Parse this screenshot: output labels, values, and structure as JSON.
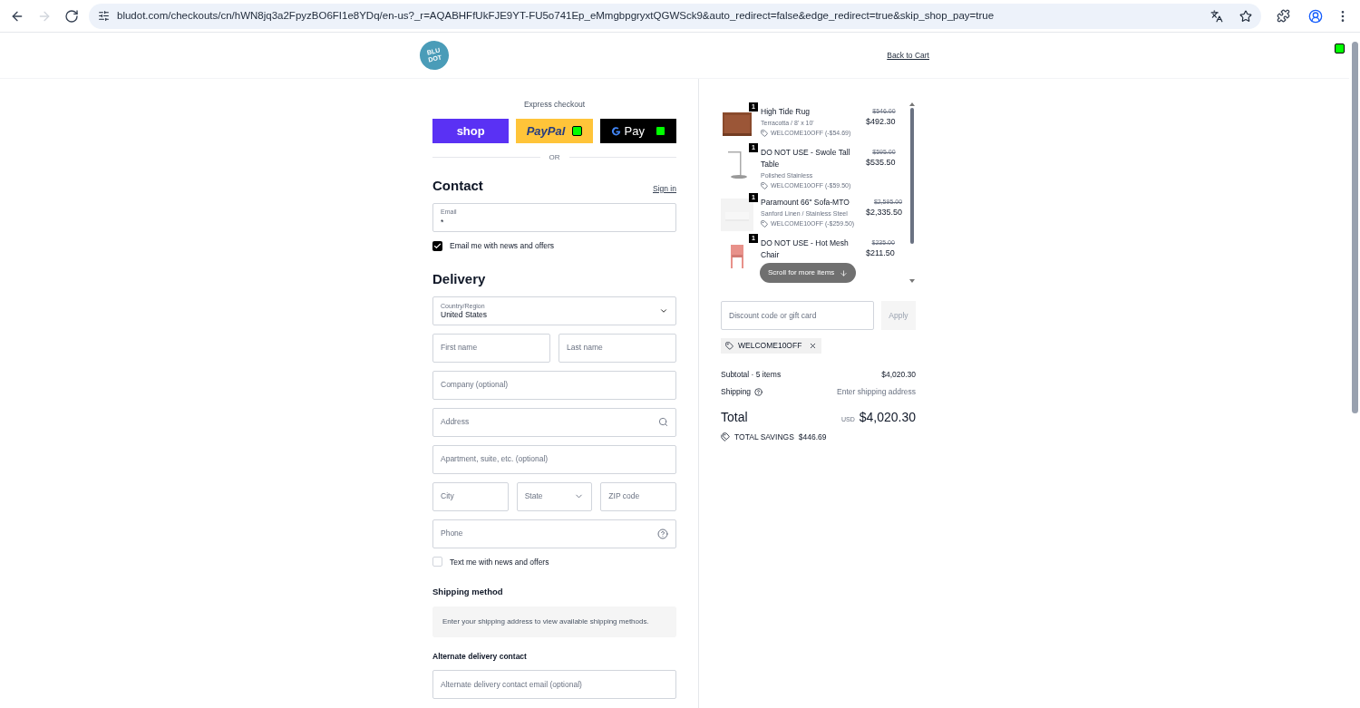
{
  "browser": {
    "url": "bludot.com/checkouts/cn/hWN8jq3a2FpyzBO6FI1e8YDq/en-us?_r=AQABHFfUkFJE9YT-FU5o741Ep_eMmgbpgryxtQGWSck9&auto_redirect=false&edge_redirect=true&skip_shop_pay=true",
    "nav": [
      {
        "kind": "back",
        "disabled": false
      },
      {
        "kind": "forward",
        "disabled": true
      },
      {
        "kind": "reload",
        "disabled": false
      }
    ]
  },
  "header": {
    "logo": [
      "BLU",
      "DOT"
    ],
    "back_link": "Back to Cart"
  },
  "express": {
    "title": "Express checkout",
    "buttons": [
      {
        "kind": "shop",
        "label": "shop"
      },
      {
        "kind": "paypal",
        "label": "PayPal"
      },
      {
        "kind": "gpay",
        "label": "Pay"
      }
    ],
    "divider": "OR"
  },
  "contact": {
    "title": "Contact",
    "sign_in": "Sign in",
    "email": {
      "label": "Email",
      "value": "*"
    },
    "newsletter": {
      "label": "Email me with news and offers",
      "checked": true
    }
  },
  "delivery": {
    "title": "Delivery",
    "country": {
      "label": "Country/Region",
      "value": "United States"
    },
    "fields": [
      [
        {
          "kind": "input",
          "placeholder": "First name"
        },
        {
          "kind": "input",
          "placeholder": "Last name"
        }
      ],
      [
        {
          "kind": "input",
          "placeholder": "Company (optional)"
        }
      ],
      [
        {
          "kind": "search",
          "placeholder": "Address"
        }
      ],
      [
        {
          "kind": "input",
          "placeholder": "Apartment, suite, etc. (optional)"
        }
      ],
      [
        {
          "kind": "input",
          "placeholder": "City"
        },
        {
          "kind": "select",
          "placeholder": "State"
        },
        {
          "kind": "input",
          "placeholder": "ZIP code"
        }
      ],
      [
        {
          "kind": "help",
          "placeholder": "Phone"
        }
      ]
    ],
    "sms": {
      "label": "Text me with news and offers",
      "checked": false
    }
  },
  "shipping": {
    "title": "Shipping method",
    "note": "Enter your shipping address to view available shipping methods."
  },
  "alternate": {
    "title": "Alternate delivery contact",
    "placeholder": "Alternate delivery contact email (optional)"
  },
  "cart": {
    "items": [
      {
        "kind": "rug",
        "qty": "1",
        "name": "High Tide Rug",
        "variant": "Terracotta / 8' x 10'",
        "discount": "WELCOME10OFF (-$54.69)",
        "was": "$546.00",
        "price": "$492.30"
      },
      {
        "kind": "table",
        "qty": "1",
        "name": "DO NOT USE - Swole Tall Table",
        "variant": "Polished Stainless",
        "discount": "WELCOME10OFF (-$59.50)",
        "was": "$595.00",
        "price": "$535.50"
      },
      {
        "kind": "sofa",
        "qty": "1",
        "name": "Paramount 66\" Sofa-MTO",
        "variant": "Sanford Linen / Stainless Steel",
        "discount": "WELCOME10OFF (-$259.50)",
        "was": "$2,595.00",
        "price": "$2,335.50"
      },
      {
        "kind": "chair",
        "qty": "1",
        "name": "DO NOT USE - Hot Mesh Chair",
        "was": "$235.00",
        "price": "$211.50"
      }
    ],
    "scroll_hint": "Scroll for more items",
    "discount_placeholder": "Discount code or gift card",
    "apply": "Apply",
    "code": "WELCOME10OFF",
    "subtotal_label": "Subtotal · 5 items",
    "subtotal": "$4,020.30",
    "shipping_label": "Shipping",
    "shipping_value": "Enter shipping address",
    "total_label": "Total",
    "currency": "USD",
    "total": "$4,020.30",
    "savings_label": "TOTAL SAVINGS",
    "savings": "$446.69"
  }
}
